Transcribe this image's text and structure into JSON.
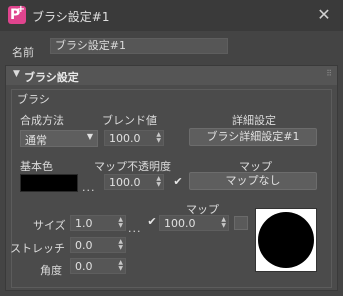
{
  "window": {
    "title": "ブラシ設定#1",
    "close_glyph": "✕"
  },
  "name_row": {
    "label": "名前",
    "value": "ブラシ設定#1"
  },
  "rollout": {
    "collapse_glyph": "▼",
    "title": "ブラシ設定",
    "grip_glyph": "⠿"
  },
  "brush_group": {
    "title": "ブラシ",
    "blend_mode": {
      "label": "合成方法",
      "value": "通常",
      "arrow": "▼"
    },
    "blend_value": {
      "label": "ブレンド値",
      "value": "100.0"
    },
    "detail": {
      "label": "詳細設定",
      "button": "ブラシ詳細設定#1"
    },
    "base_color": {
      "label": "基本色",
      "dots": "...",
      "color": "#000000"
    },
    "map_opacity": {
      "label": "マップ不透明度",
      "value": "100.0",
      "checked": "✔"
    },
    "map1": {
      "label": "マップ",
      "button": "マップなし"
    },
    "size": {
      "label": "サイズ",
      "value": "1.0",
      "dots": "...",
      "checked": "✔"
    },
    "map2": {
      "label": "マップ",
      "value": "100.0"
    },
    "stretch": {
      "label": "ストレッチ",
      "value": "0.0"
    },
    "angle": {
      "label": "角度",
      "value": "0.0"
    },
    "spinner_arrows": "▲▼"
  }
}
